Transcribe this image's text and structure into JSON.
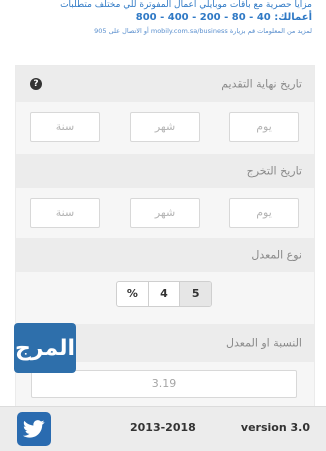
{
  "banner": {
    "line1": "مزايا حصرية مع باقات موبايلي أعمال المفوترة للي مختلف متطلبات",
    "line2": "أعمالك: 40 - 80 - 200 - 400 - 800",
    "line3": "لمزيد من المعلومات قم بزيارة mobily.com.sa/business أو الاتصال على 905"
  },
  "form": {
    "deadline": {
      "label": "تاريخ نهاية التقديم",
      "day": "يوم",
      "month": "شهر",
      "year": "سنة"
    },
    "graduation": {
      "label": "تاريخ التخرج",
      "day": "يوم",
      "month": "شهر",
      "year": "سنة"
    },
    "average_type": {
      "label": "نوع المعدل",
      "options": [
        "%",
        "4",
        "5"
      ],
      "selected": "5"
    },
    "gpa": {
      "label": "النسبة او المعدل",
      "value": "3.19"
    }
  },
  "logo": {
    "text": "المرج"
  },
  "footer": {
    "years": "2013-2018",
    "version": "version 3.0"
  },
  "icons": {
    "help": "help-icon",
    "twitter": "twitter-icon"
  },
  "colors": {
    "accent": "#2f79c5",
    "twitter": "#2a6bb0",
    "logo": "#2e6fab"
  }
}
